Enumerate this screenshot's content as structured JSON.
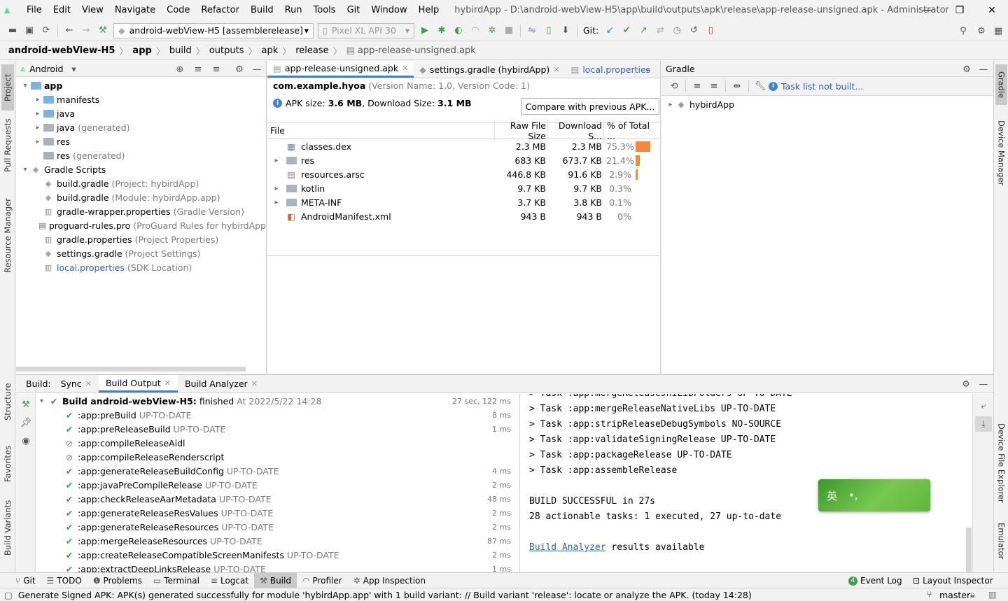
{
  "menubar": {
    "items": [
      "File",
      "Edit",
      "View",
      "Navigate",
      "Code",
      "Refactor",
      "Build",
      "Run",
      "Tools",
      "Git",
      "Window",
      "Help"
    ],
    "title": "hybirdApp - D:\\android-webView-H5\\app\\build\\outputs\\apk\\release\\app-release-unsigned.apk - Administrator"
  },
  "toolbar": {
    "run_config": "android-webView-H5 [assemblerelease]",
    "device": "Pixel XL API 30",
    "git_label": "Git:"
  },
  "breadcrumb": [
    "android-webView-H5",
    "app",
    "build",
    "outputs",
    "apk",
    "release",
    "app-release-unsigned.apk"
  ],
  "left_strip": [
    "Project",
    "Pull Requests",
    "Resource Manager",
    "Structure",
    "Favorites",
    "Build Variants"
  ],
  "right_strip": [
    "Gradle",
    "Device Manager",
    "Device File Explorer",
    "Emulator"
  ],
  "project": {
    "view_label": "Android",
    "tree": [
      {
        "label": "app",
        "suffix": "",
        "level": 0,
        "arrow": "▾",
        "icon": "folder",
        "bold": true
      },
      {
        "label": "manifests",
        "suffix": "",
        "level": 1,
        "arrow": "▸",
        "icon": "folder"
      },
      {
        "label": "java",
        "suffix": "",
        "level": 1,
        "arrow": "▸",
        "icon": "folder"
      },
      {
        "label": "java",
        "suffix": "(generated)",
        "level": 1,
        "arrow": "▸",
        "icon": "folder-gen"
      },
      {
        "label": "res",
        "suffix": "",
        "level": 1,
        "arrow": "▸",
        "icon": "folder-res"
      },
      {
        "label": "res",
        "suffix": "(generated)",
        "level": 1,
        "arrow": "",
        "icon": "folder-res"
      },
      {
        "label": "Gradle Scripts",
        "suffix": "",
        "level": 0,
        "arrow": "▾",
        "icon": "gradle"
      },
      {
        "label": "build.gradle",
        "suffix": "(Project: hybirdApp)",
        "level": 1,
        "arrow": "",
        "icon": "gradle"
      },
      {
        "label": "build.gradle",
        "suffix": "(Module: hybirdApp.app)",
        "level": 1,
        "arrow": "",
        "icon": "gradle"
      },
      {
        "label": "gradle-wrapper.properties",
        "suffix": "(Gradle Version)",
        "level": 1,
        "arrow": "",
        "icon": "props"
      },
      {
        "label": "proguard-rules.pro",
        "suffix": "(ProGuard Rules for hybirdApp",
        "level": 1,
        "arrow": "",
        "icon": "file"
      },
      {
        "label": "gradle.properties",
        "suffix": "(Project Properties)",
        "level": 1,
        "arrow": "",
        "icon": "props"
      },
      {
        "label": "settings.gradle",
        "suffix": "(Project Settings)",
        "level": 1,
        "arrow": "",
        "icon": "gradle"
      },
      {
        "label": "local.properties",
        "suffix": "(SDK Location)",
        "level": 1,
        "arrow": "",
        "icon": "props",
        "link": true
      }
    ]
  },
  "editor": {
    "tabs": [
      {
        "label": "app-release-unsigned.apk",
        "active": true
      },
      {
        "label": "settings.gradle (hybirdApp)",
        "active": false
      },
      {
        "label": "local.properties",
        "active": false,
        "link": true
      }
    ],
    "package": "com.example.hyoa",
    "version": "(Version Name: 1.0, Version Code: 1)",
    "apk_size_label": "APK size:",
    "apk_size": "3.6 MB",
    "download_size_label": ", Download Size:",
    "download_size": "3.1 MB",
    "compare_button": "Compare with previous APK...",
    "columns": [
      "File",
      "Raw File Size",
      "Download S...",
      "% of Total ..."
    ],
    "rows": [
      {
        "name": "classes.dex",
        "raw": "2.3 MB",
        "download": "2.3 MB",
        "pct": "75.3%",
        "share": 0.753,
        "arrow": "",
        "icon": "dex"
      },
      {
        "name": "res",
        "raw": "683 KB",
        "download": "673.7 KB",
        "pct": "21.4%",
        "share": 0.214,
        "arrow": "▸",
        "icon": "folder"
      },
      {
        "name": "resources.arsc",
        "raw": "446.8 KB",
        "download": "91.6 KB",
        "pct": "2.9%",
        "share": 0.029,
        "arrow": "",
        "icon": "arsc"
      },
      {
        "name": "kotlin",
        "raw": "9.7 KB",
        "download": "9.7 KB",
        "pct": "0.3%",
        "share": 0.003,
        "arrow": "▸",
        "icon": "folder"
      },
      {
        "name": "META-INF",
        "raw": "3.7 KB",
        "download": "3.8 KB",
        "pct": "0.1%",
        "share": 0.001,
        "arrow": "▸",
        "icon": "folder"
      },
      {
        "name": "AndroidManifest.xml",
        "raw": "943 B",
        "download": "943 B",
        "pct": "0%",
        "share": 0,
        "arrow": "",
        "icon": "xml"
      }
    ]
  },
  "gradle": {
    "title": "Gradle",
    "task_msg": "Task list not built...",
    "root": "hybirdApp"
  },
  "build": {
    "label": "Build:",
    "tabs": [
      {
        "label": "Sync",
        "active": false
      },
      {
        "label": "Build Output",
        "active": true
      },
      {
        "label": "Build Analyzer",
        "active": false
      }
    ],
    "root": {
      "name": "Build android-webView-H5:",
      "status": "finished",
      "at": "At 2022/5/22 14:28",
      "time": "27 sec, 122 ms"
    },
    "tasks": [
      {
        "name": ":app:preBuild",
        "state": "UP-TO-DATE",
        "time": "8 ms",
        "icon": "ok"
      },
      {
        "name": ":app:preReleaseBuild",
        "state": "UP-TO-DATE",
        "time": "1 ms",
        "icon": "ok"
      },
      {
        "name": ":app:compileReleaseAidl",
        "state": "",
        "time": "",
        "icon": "skip"
      },
      {
        "name": ":app:compileReleaseRenderscript",
        "state": "",
        "time": "",
        "icon": "skip"
      },
      {
        "name": ":app:generateReleaseBuildConfig",
        "state": "UP-TO-DATE",
        "time": "4 ms",
        "icon": "ok"
      },
      {
        "name": ":app:javaPreCompileRelease",
        "state": "UP-TO-DATE",
        "time": "2 ms",
        "icon": "ok"
      },
      {
        "name": ":app:checkReleaseAarMetadata",
        "state": "UP-TO-DATE",
        "time": "48 ms",
        "icon": "ok"
      },
      {
        "name": ":app:generateReleaseResValues",
        "state": "UP-TO-DATE",
        "time": "2 ms",
        "icon": "ok"
      },
      {
        "name": ":app:generateReleaseResources",
        "state": "UP-TO-DATE",
        "time": "2 ms",
        "icon": "ok"
      },
      {
        "name": ":app:mergeReleaseResources",
        "state": "UP-TO-DATE",
        "time": "87 ms",
        "icon": "ok"
      },
      {
        "name": ":app:createReleaseCompatibleScreenManifests",
        "state": "UP-TO-DATE",
        "time": "2 ms",
        "icon": "ok"
      },
      {
        "name": ":app:extractDeepLinksRelease",
        "state": "UP-TO-DATE",
        "time": "1 ms",
        "icon": "ok"
      }
    ],
    "console": [
      "> Task :app:mergeReleaseJniLibFolders UP-TO-DATE",
      "> Task :app:mergeReleaseNativeLibs UP-TO-DATE",
      "> Task :app:stripReleaseDebugSymbols NO-SOURCE",
      "> Task :app:validateSigningRelease UP-TO-DATE",
      "> Task :app:packageRelease UP-TO-DATE",
      "> Task :app:assembleRelease",
      "",
      "BUILD SUCCESSFUL in 27s",
      "28 actionable tasks: 1 executed, 27 up-to-date",
      ""
    ],
    "analyzer_link": "Build Analyzer",
    "analyzer_tail": " results available"
  },
  "bottom_tools": {
    "left": [
      {
        "label": "Git",
        "icon": "git-icon"
      },
      {
        "label": "TODO",
        "icon": "todo-icon"
      },
      {
        "label": "Problems",
        "icon": "problems-icon"
      },
      {
        "label": "Terminal",
        "icon": "terminal-icon"
      },
      {
        "label": "Logcat",
        "icon": "logcat-icon"
      },
      {
        "label": "Build",
        "icon": "build-icon",
        "active": true
      },
      {
        "label": "Profiler",
        "icon": "profiler-icon"
      },
      {
        "label": "App Inspection",
        "icon": "app-inspection-icon"
      }
    ],
    "event_log": "Event Log",
    "event_count": "4",
    "layout_inspector": "Layout Inspector"
  },
  "status": {
    "message": "Generate Signed APK: APK(s) generated successfully for module 'hybirdApp.app' with 1 build variant: // Build variant 'release': locate or analyze the APK. (today 14:28)",
    "branch": "master"
  },
  "ime": {
    "lang": "英",
    "punct": "•,"
  },
  "colors": {
    "accent": "#4083c9",
    "success": "#3aa04a",
    "bar": "#f28a3c",
    "link": "#2c5fbd"
  }
}
